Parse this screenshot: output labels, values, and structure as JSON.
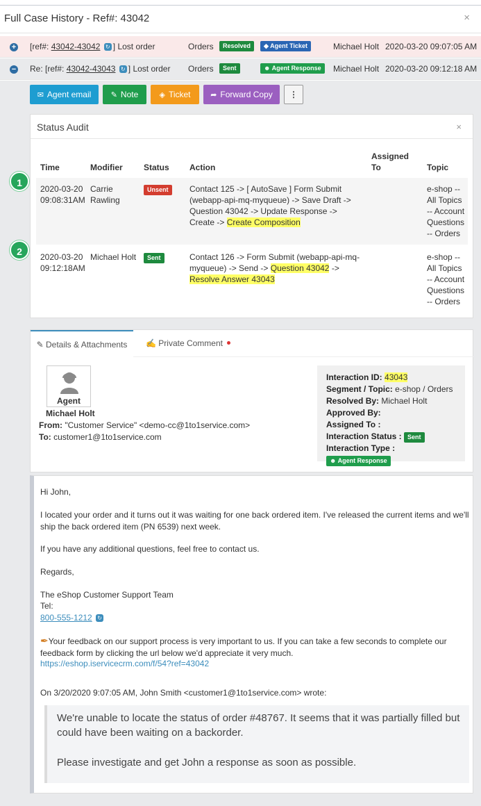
{
  "window": {
    "title": "Full Case History - Ref#: 43042",
    "close": "×"
  },
  "cases": [
    {
      "toggle": "+",
      "prefix": "[ref#: ",
      "ref": "43042-43042",
      "subject": "Lost order",
      "queue": "Orders",
      "status": "Resolved",
      "type": "Agent Ticket",
      "agent": "Michael Holt",
      "datetime": "2020-03-20 09:07:05 AM"
    },
    {
      "toggle": "−",
      "prefix": "Re: [ref#: ",
      "ref": "43042-43043",
      "subject": "Lost order",
      "queue": "Orders",
      "status": "Sent",
      "type": "Agent Response",
      "agent": "Michael Holt",
      "datetime": "2020-03-20 09:12:18 AM"
    }
  ],
  "toolbar": {
    "email": "Agent email",
    "note": "Note",
    "ticket": "Ticket",
    "forward": "Forward Copy",
    "more": "⋮"
  },
  "audit": {
    "title": "Status Audit",
    "close": "×",
    "headers": {
      "time": "Time",
      "modifier": "Modifier",
      "status": "Status",
      "action": "Action",
      "assigned": "Assigned To",
      "topic": "Topic"
    },
    "rows": [
      {
        "step": "1",
        "date": "2020-03-20",
        "time": "09:08:31AM",
        "modifier": "Carrie Rawling",
        "status": "Unsent",
        "action_plain": "Contact 125 -> [ AutoSave ] Form Submit (webapp-api-mq-myqueue) -> Save Draft -> Question 43042 -> Update Response -> Create ->",
        "action_hl1": "Create Composition",
        "topic": "e-shop -- All Topics -- Account Questions -- Orders"
      },
      {
        "step": "2",
        "date": "2020-03-20",
        "time": "09:12:18AM",
        "modifier": "Michael Holt",
        "status": "Sent",
        "action_plain": "Contact 126 -> Form Submit (webapp-api-mq-myqueue) -> Send ->",
        "action_hl1": "Question 43042",
        "action_arrow": " -> ",
        "action_hl2": "Resolve Answer 43043",
        "topic": "e-shop -- All Topics -- Account Questions -- Orders"
      }
    ]
  },
  "details": {
    "tab1": "Details & Attachments",
    "tab2": "Private Comment",
    "avatar_label": "Agent",
    "agent_name": "Michael Holt",
    "from_label": "From:",
    "from_value": "\"Customer Service\" <demo-cc@1to1service.com>",
    "to_label": "To:",
    "to_value": "customer1@1to1service.com",
    "info": {
      "interaction_id_label": "Interaction ID:",
      "interaction_id": "43043",
      "segment_label": "Segment / Topic:",
      "segment": "e-shop / Orders",
      "resolved_label": "Resolved By:",
      "resolved": "Michael Holt",
      "approved_label": "Approved By:",
      "assigned_label": "Assigned To :",
      "status_label": "Interaction Status :",
      "status": "Sent",
      "type_label": "Interaction Type :",
      "type": "Agent Response"
    }
  },
  "message": {
    "greeting": "Hi John,",
    "para1": "I located your order and it turns out it was waiting for one back ordered item. I've released the current items and we'll ship the back ordered item (PN  6539) next week.",
    "para2": "If you have any additional questions, feel free to contact us.",
    "regards": "Regards,",
    "sig1": "The eShop Customer Support Team",
    "sig2": "Tel:",
    "phone": "800-555-1212",
    "feedback": "Your feedback on our support process is very important to us. If you can take a few seconds to complete our feedback form by clicking the url below we'd appreciate it very much.",
    "feedback_url": "https://eshop.iservicecrm.com/f/54?ref=43042",
    "quote_header": "On 3/20/2020 9:07:05 AM, John Smith <customer1@1to1service.com> wrote:",
    "quote1": "We're unable to locate the status of order #48767. It seems that it was partially filled but could have been waiting on a backorder.",
    "quote2": "Please investigate and get John a response as soon as possible."
  },
  "colors": {
    "resolved": "#1e8a3e",
    "sent": "#1e8a3e",
    "unsent": "#d33d2f",
    "agent_ticket": "#2a66b4",
    "agent_response": "#1f9d4c",
    "highlight": "#ffff66"
  },
  "icons": {
    "email": "envelope-icon",
    "note": "pencil-square-icon",
    "ticket": "tag-icon",
    "forward": "share-icon",
    "paperclip": "paperclip-icon",
    "edit": "edit-icon",
    "link": "sync-icon",
    "feedback": "pen-icon"
  }
}
